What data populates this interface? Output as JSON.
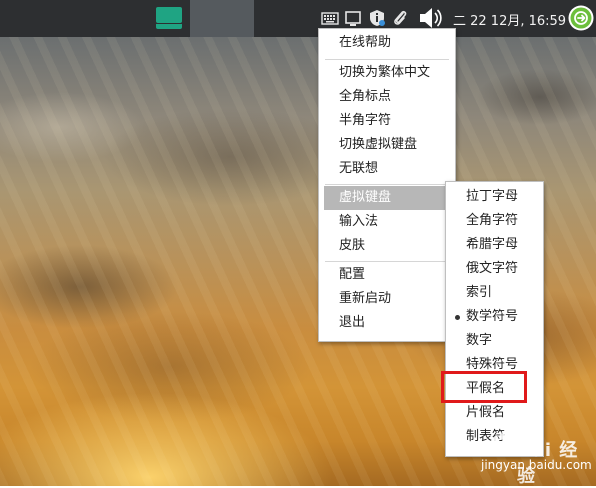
{
  "panel": {
    "clock": "二 22 12月, 16:59",
    "tray_icons": [
      "keyboard-icon",
      "window-icon",
      "info-shield-icon",
      "paperclip-icon",
      "volume-icon"
    ],
    "power_icon": "power-icon",
    "task_icon": "laptop-icon"
  },
  "menu": {
    "items": [
      {
        "label": "在线帮助"
      },
      {
        "label": "切换为繁体中文"
      },
      {
        "label": "全角标点"
      },
      {
        "label": "半角字符"
      },
      {
        "label": "切换虚拟键盘"
      },
      {
        "label": "无联想"
      },
      {
        "label": "虚拟键盘",
        "selected": true,
        "submenu": true
      },
      {
        "label": "输入法",
        "submenu": true
      },
      {
        "label": "皮肤",
        "submenu": true
      },
      {
        "label": "配置"
      },
      {
        "label": "重新启动"
      },
      {
        "label": "退出"
      }
    ]
  },
  "submenu": {
    "items": [
      {
        "label": "拉丁字母"
      },
      {
        "label": "全角字符"
      },
      {
        "label": "希腊字母"
      },
      {
        "label": "俄文字符"
      },
      {
        "label": "索引"
      },
      {
        "label": "数学符号",
        "checked": true
      },
      {
        "label": "数字"
      },
      {
        "label": "特殊符号"
      },
      {
        "label": "平假名",
        "highlighted": true
      },
      {
        "label": "片假名"
      },
      {
        "label": "制表符"
      }
    ]
  },
  "watermark": {
    "brand": "Bai 经验",
    "url": "jingyan.baidu.com"
  },
  "colors": {
    "panel_bg": "#2d2f31",
    "task_icon": "#1fa483",
    "power": "#6cbf3c",
    "selection": "#b7b7b7",
    "highlight_box": "#e0191a"
  }
}
